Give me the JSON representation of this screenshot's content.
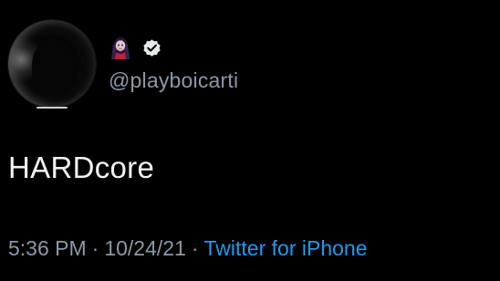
{
  "tweet": {
    "handle": "@playboicarti",
    "text": "HARDcore",
    "time": "5:36 PM",
    "separator_1": "·",
    "date": "10/24/21",
    "separator_2": "·",
    "source": "Twitter for iPhone",
    "display_name_icon": "vampire-emoji-icon",
    "verified_icon": "verified-badge-icon"
  },
  "colors": {
    "background": "#000000",
    "primary_text": "#f2f2f2",
    "secondary_text": "#8b98a5",
    "link": "#1d9bf0"
  }
}
